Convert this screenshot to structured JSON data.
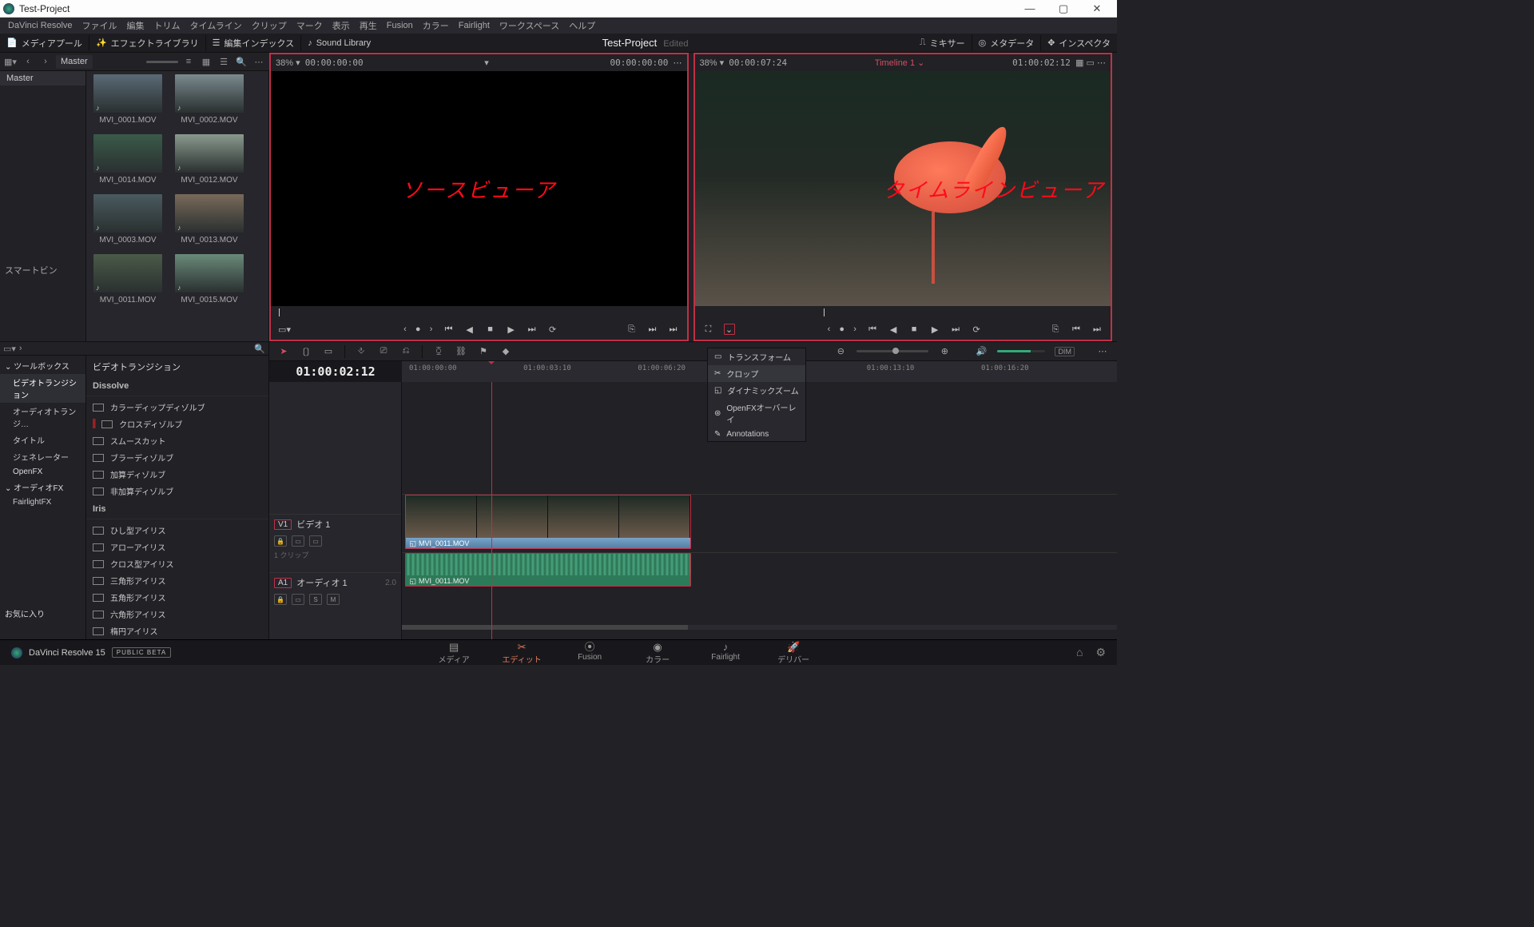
{
  "window": {
    "title": "Test-Project"
  },
  "menus": [
    "DaVinci Resolve",
    "ファイル",
    "編集",
    "トリム",
    "タイムライン",
    "クリップ",
    "マーク",
    "表示",
    "再生",
    "Fusion",
    "カラー",
    "Fairlight",
    "ワークスペース",
    "ヘルプ"
  ],
  "toolbar": {
    "media_pool": "メディアプール",
    "effects_lib": "エフェクトライブラリ",
    "edit_index": "編集インデックス",
    "sound_lib": "Sound Library",
    "project": "Test-Project",
    "edited": "Edited",
    "mixer": "ミキサー",
    "metadata": "メタデータ",
    "inspector": "インスペクタ"
  },
  "pool": {
    "location": "Master",
    "tree_master": "Master",
    "smartbin": "スマートビン",
    "favorites": "お気に入り",
    "clips": [
      "MVI_0001.MOV",
      "MVI_0002.MOV",
      "MVI_0014.MOV",
      "MVI_0012.MOV",
      "MVI_0003.MOV",
      "MVI_0013.MOV",
      "MVI_0011.MOV",
      "MVI_0015.MOV"
    ]
  },
  "source_viewer": {
    "zoom": "38%",
    "tc_left": "00:00:00:00",
    "tc_right": "00:00:00:00",
    "overlay": "ソースビューア"
  },
  "timeline_viewer": {
    "zoom": "38%",
    "tc_left": "00:00:07:24",
    "name": "Timeline 1",
    "tc_right": "01:00:02:12",
    "overlay": "タイムラインビューア"
  },
  "popup": {
    "transform": "トランスフォーム",
    "crop": "クロップ",
    "dynamic_zoom": "ダイナミックズーム",
    "openfx": "OpenFXオーバーレイ",
    "annotations": "Annotations"
  },
  "fx": {
    "header": "ビデオトランジション",
    "tree": {
      "toolbox": "ツールボックス",
      "video_trans": "ビデオトランジション",
      "audio_trans": "オーディオトランジ…",
      "titles": "タイトル",
      "generators": "ジェネレーター",
      "openfx": "OpenFX",
      "audiofx": "オーディオFX",
      "fairlightfx": "FairlightFX"
    },
    "groups": [
      {
        "name": "Dissolve",
        "items": [
          "カラーディップディゾルブ",
          "クロスディゾルブ",
          "スムースカット",
          "ブラーディゾルブ",
          "加算ディゾルブ",
          "非加算ディゾルブ"
        ]
      },
      {
        "name": "Iris",
        "items": [
          "ひし型アイリス",
          "アローアイリス",
          "クロス型アイリス",
          "三角形アイリス",
          "五角形アイリス",
          "六角形アイリス",
          "楕円アイリス"
        ]
      }
    ]
  },
  "timeline": {
    "current_tc": "01:00:02:12",
    "ruler": [
      "01:00:00:00",
      "01:00:03:10",
      "01:00:06:20",
      "",
      "01:00:13:10",
      "01:00:16:20"
    ],
    "video_track": {
      "tag": "V1",
      "name": "ビデオ 1",
      "hint": "1 クリップ"
    },
    "audio_track": {
      "tag": "A1",
      "name": "オーディオ 1",
      "level": "2.0"
    },
    "clip_name": "MVI_0011.MOV",
    "dim": "DIM"
  },
  "bottom": {
    "brand": "DaVinci Resolve 15",
    "beta": "PUBLIC BETA",
    "pages": [
      "メディア",
      "エディット",
      "Fusion",
      "カラー",
      "Fairlight",
      "デリバー"
    ]
  }
}
